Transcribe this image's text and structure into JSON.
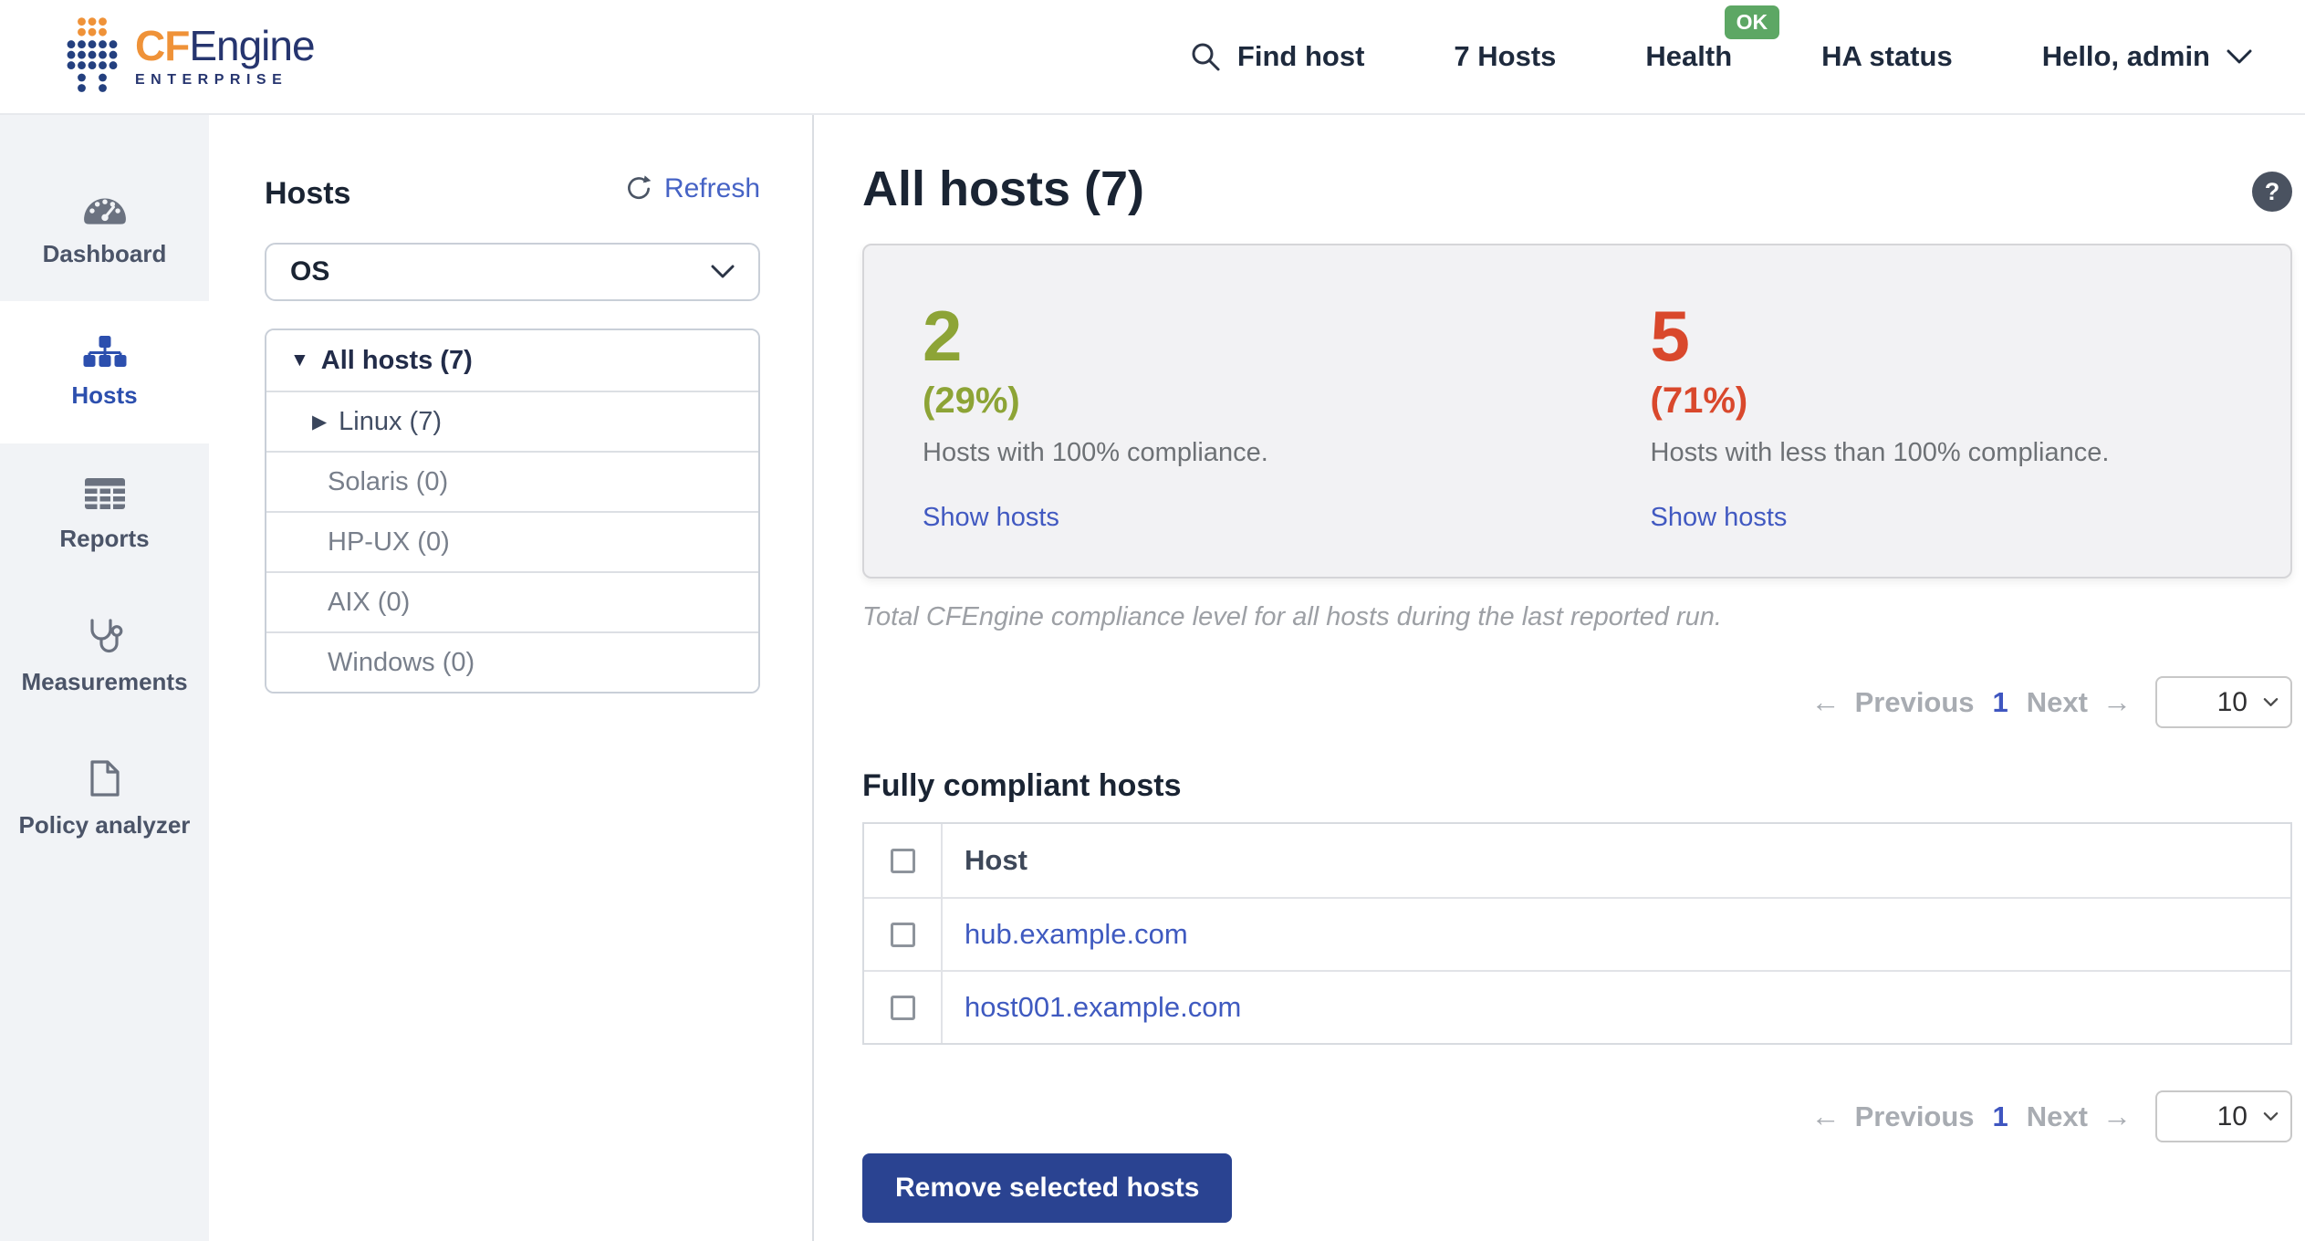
{
  "header": {
    "logo": {
      "brand_cf": "CF",
      "brand_engine": "Engine",
      "subtitle": "ENTERPRISE"
    },
    "nav": {
      "find_host": "Find host",
      "hosts_count": "7 Hosts",
      "health": "Health",
      "health_badge": "OK",
      "ha_status": "HA status",
      "user_menu": "Hello, admin"
    }
  },
  "sidebar": {
    "items": [
      {
        "label": "Dashboard",
        "icon": "gauge-icon",
        "active": false
      },
      {
        "label": "Hosts",
        "icon": "sitemap-icon",
        "active": true
      },
      {
        "label": "Reports",
        "icon": "table-grid-icon",
        "active": false
      },
      {
        "label": "Measurements",
        "icon": "stethoscope-icon",
        "active": false
      },
      {
        "label": "Policy analyzer",
        "icon": "document-icon",
        "active": false
      }
    ]
  },
  "hosts_panel": {
    "title": "Hosts",
    "refresh_label": "Refresh",
    "filter_selected": "OS",
    "tree": [
      {
        "label": "All hosts (7)",
        "caret": "▼",
        "level": 0,
        "state": "expanded"
      },
      {
        "label": "Linux (7)",
        "caret": "▶",
        "level": 1,
        "state": "collapsed"
      },
      {
        "label": "Solaris (0)",
        "level": 1
      },
      {
        "label": "HP-UX (0)",
        "level": 1
      },
      {
        "label": "AIX (0)",
        "level": 1
      },
      {
        "label": "Windows (0)",
        "level": 1
      }
    ]
  },
  "main": {
    "title": "All hosts (7)",
    "help_label": "?",
    "summary": {
      "compliant": {
        "count": "2",
        "percent": "(29%)",
        "caption": "Hosts with 100% compliance.",
        "link": "Show hosts"
      },
      "noncompliant": {
        "count": "5",
        "percent": "(71%)",
        "caption": "Hosts with less than 100% compliance.",
        "link": "Show hosts"
      }
    },
    "note": "Total CFEngine compliance level for all hosts during the last reported run.",
    "pagination": {
      "prev_arrow": "←",
      "previous": "Previous",
      "page": "1",
      "next": "Next",
      "next_arrow": "→",
      "page_size": "10"
    },
    "table": {
      "title": "Fully compliant hosts",
      "column_host": "Host",
      "rows": [
        {
          "host": "hub.example.com"
        },
        {
          "host": "host001.example.com"
        }
      ]
    },
    "remove_button": "Remove selected hosts"
  },
  "colors": {
    "accent_blue": "#2c4fae",
    "link_blue": "#4159c1",
    "button_blue": "#2a4391",
    "compliant_green": "#8da436",
    "noncompliant_red": "#d9482c",
    "badge_green": "#5da764",
    "navy_text": "#1a2433"
  },
  "icons": {
    "search": "magnifier",
    "refresh": "circular-arrow",
    "help": "question-circle",
    "chevron": "chevron-down",
    "expanded": "triangle-down",
    "collapsed": "triangle-right"
  }
}
